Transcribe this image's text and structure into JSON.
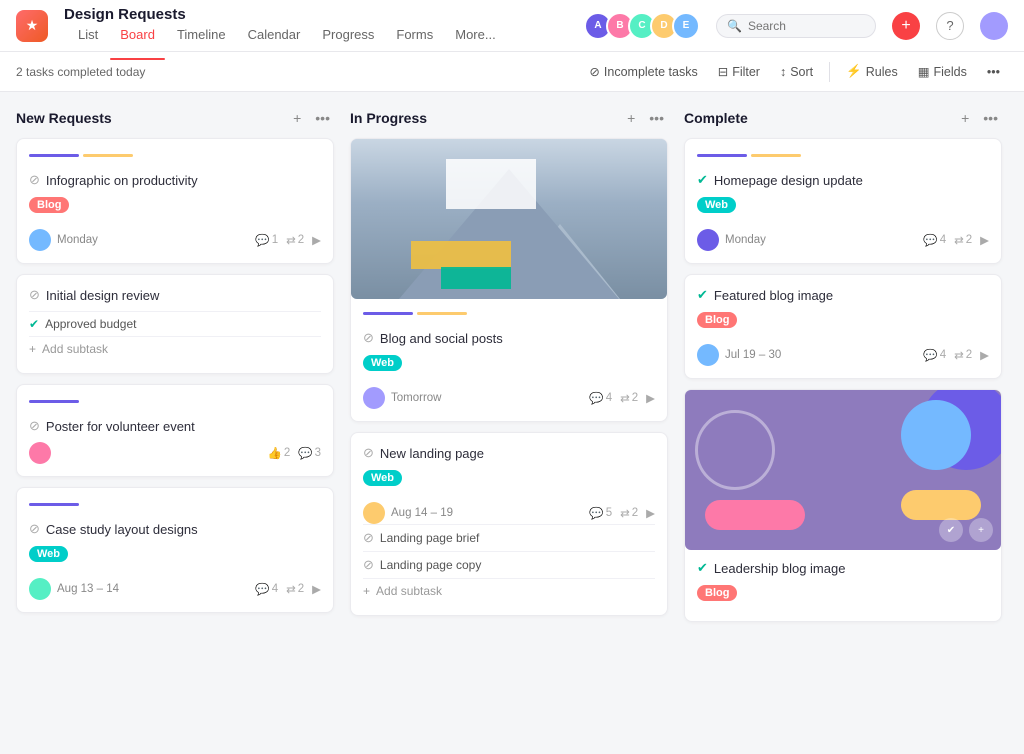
{
  "app": {
    "icon": "★",
    "title": "Design Requests",
    "nav": [
      "List",
      "Board",
      "Timeline",
      "Calendar",
      "Progress",
      "Forms",
      "More..."
    ],
    "active_nav": "Board"
  },
  "header": {
    "avatars": [
      "A",
      "B",
      "C",
      "D",
      "E"
    ],
    "search_placeholder": "Search",
    "btn_plus": "+",
    "btn_help": "?"
  },
  "toolbar": {
    "status_text": "2 tasks completed today",
    "incomplete_tasks": "Incomplete tasks",
    "filter": "Filter",
    "sort": "Sort",
    "rules": "Rules",
    "fields": "Fields"
  },
  "columns": [
    {
      "id": "new-requests",
      "title": "New Requests",
      "cards": [
        {
          "id": "card-1",
          "title": "Infographic on productivity",
          "tag": "Blog",
          "tag_type": "blog",
          "date": "Monday",
          "avatar_class": "ca1",
          "comments": "1",
          "attachments": "2",
          "checked": false
        },
        {
          "id": "card-2",
          "title": "Initial design review",
          "subtasks": [
            "Approved budget"
          ],
          "add_subtask": "Add subtask",
          "checked": false
        },
        {
          "id": "card-3",
          "title": "Poster for volunteer event",
          "avatar_class": "ca2",
          "likes": "2",
          "comments": "3",
          "checked": false
        },
        {
          "id": "card-4",
          "title": "Case study layout designs",
          "tag": "Web",
          "tag_type": "web",
          "date": "Aug 13 – 14",
          "avatar_class": "ca3",
          "comments": "4",
          "attachments": "2",
          "checked": false
        }
      ]
    },
    {
      "id": "in-progress",
      "title": "In Progress",
      "cards": [
        {
          "id": "card-5",
          "title": "Blog and social posts",
          "has_image": "mountain",
          "tag": "Web",
          "tag_type": "web",
          "date": "Tomorrow",
          "avatar_class": "ca4",
          "comments": "4",
          "attachments": "2",
          "checked": false
        },
        {
          "id": "card-6",
          "title": "New landing page",
          "tag": "Web",
          "tag_type": "web",
          "date": "Aug 14 – 19",
          "avatar_class": "ca5",
          "comments": "5",
          "attachments": "2",
          "subtasks": [
            "Landing page brief",
            "Landing page copy"
          ],
          "add_subtask": "Add subtask",
          "checked": false
        }
      ]
    },
    {
      "id": "complete",
      "title": "Complete",
      "cards": [
        {
          "id": "card-7",
          "title": "Homepage design update",
          "tag": "Web",
          "tag_type": "web",
          "date": "Monday",
          "avatar_class": "ca6",
          "comments": "4",
          "attachments": "2",
          "checked": true
        },
        {
          "id": "card-8",
          "title": "Featured blog image",
          "tag": "Blog",
          "tag_type": "blog",
          "date": "Jul 19 – 30",
          "avatar_class": "ca1",
          "comments": "4",
          "attachments": "2",
          "checked": true
        },
        {
          "id": "card-9",
          "title": "Leadership blog image",
          "has_image": "abstract",
          "tag": "Blog",
          "tag_type": "blog",
          "checked": true
        }
      ]
    }
  ]
}
